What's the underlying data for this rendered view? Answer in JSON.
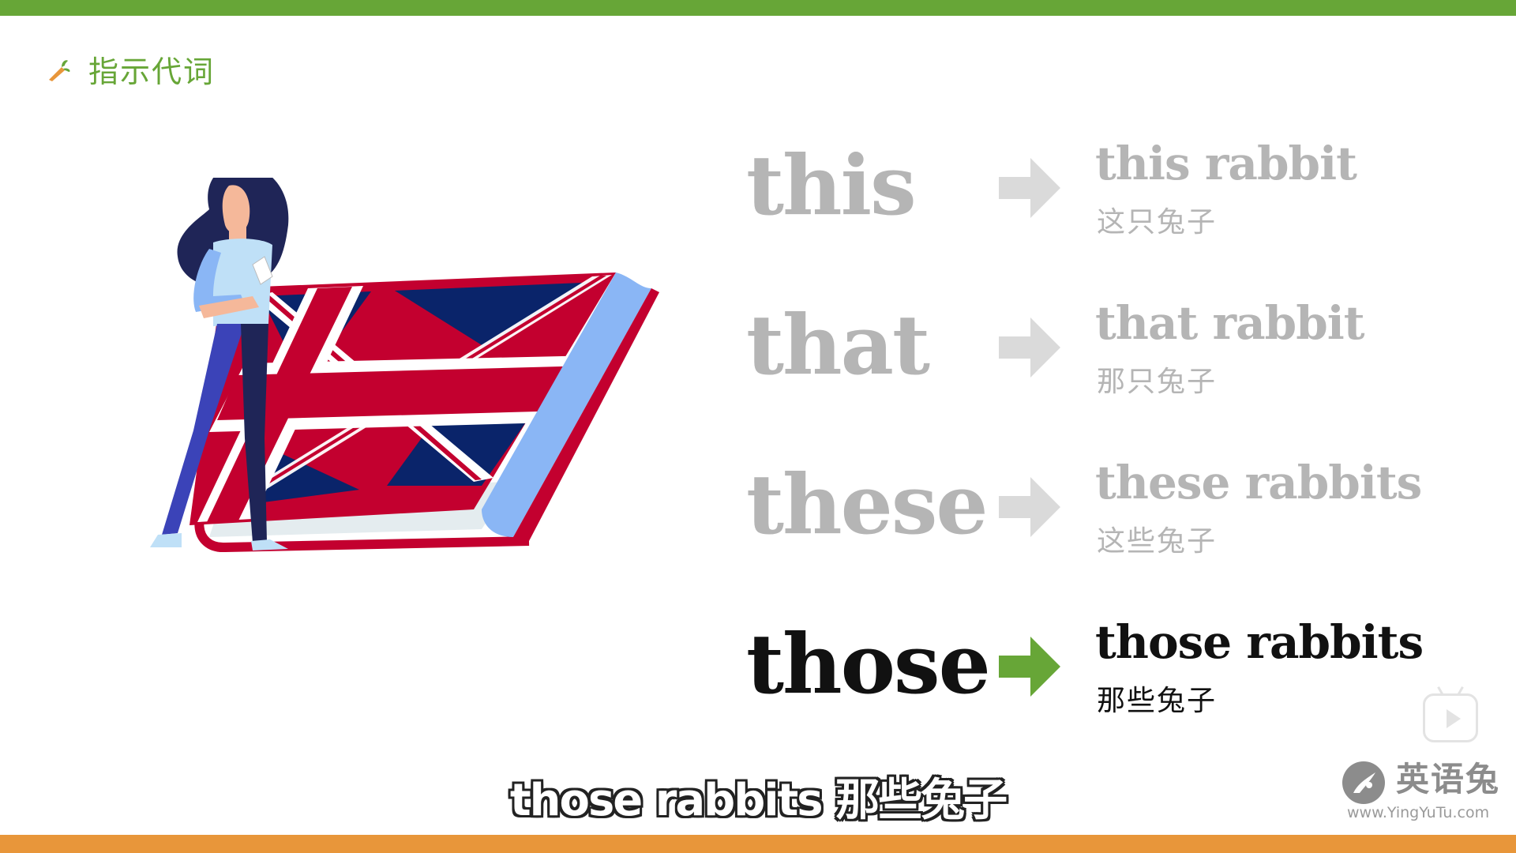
{
  "header": {
    "section_title": "指示代词",
    "icon": "carrot-icon"
  },
  "pronouns": [
    {
      "word": "this",
      "phrase": "this rabbit",
      "translation": "这只兔子",
      "active": false
    },
    {
      "word": "that",
      "phrase": "that rabbit",
      "translation": "那只兔子",
      "active": false
    },
    {
      "word": "these",
      "phrase": "these rabbits",
      "translation": "这些兔子",
      "active": false
    },
    {
      "word": "those",
      "phrase": "those rabbits",
      "translation": "那些兔子",
      "active": true
    }
  ],
  "subtitle": "those rabbits 那些兔子",
  "watermark": {
    "brand": "英语兔",
    "url": "www.YingYuTu.com"
  },
  "colors": {
    "accent_green": "#67a637",
    "accent_orange": "#e8963a",
    "inactive_gray": "#b5b5b5",
    "active_black": "#111111"
  }
}
